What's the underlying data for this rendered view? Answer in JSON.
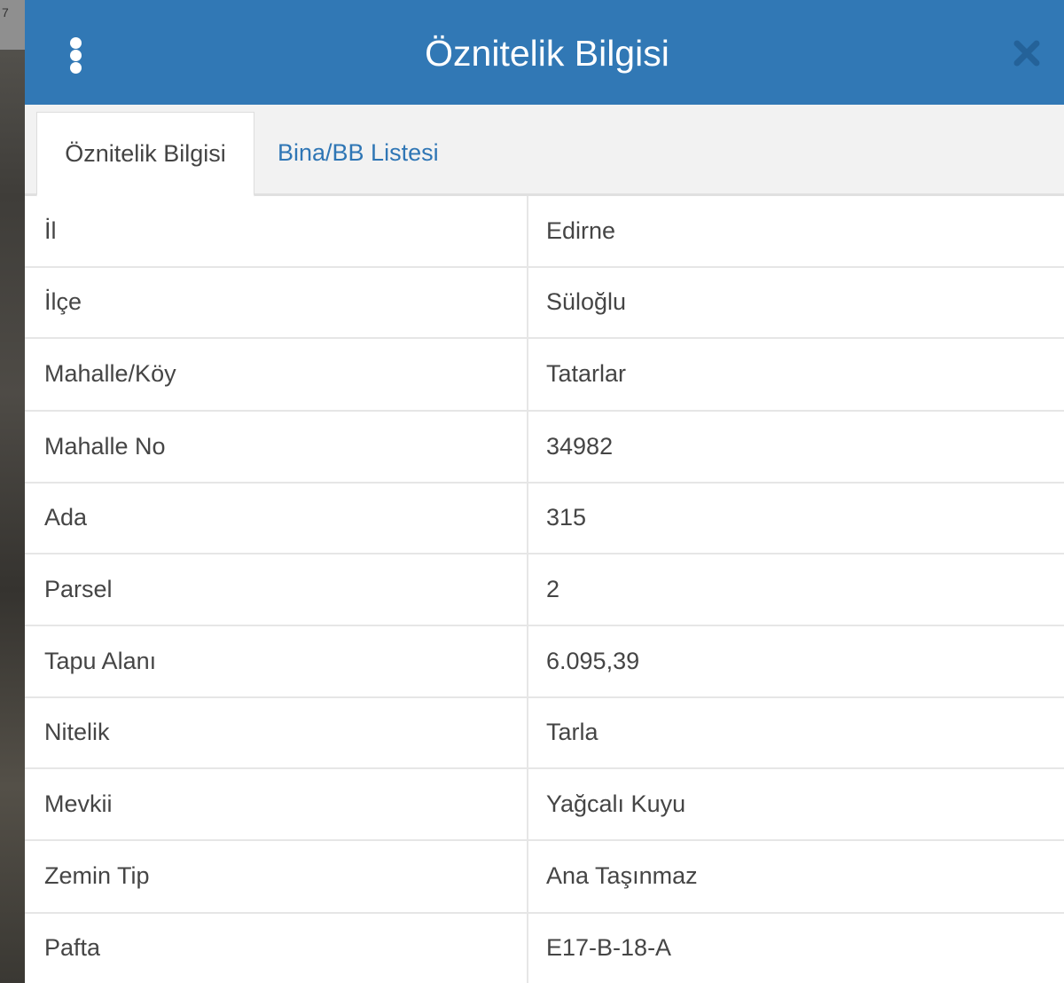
{
  "background": {
    "edge_label": "7"
  },
  "header": {
    "title": "Öznitelik Bilgisi",
    "background_color": "#3178b5",
    "menu_icon": "vertical-dots-icon",
    "close_icon": "close-icon"
  },
  "tabs": [
    {
      "label": "Öznitelik Bilgisi",
      "active": true
    },
    {
      "label": "Bina/BB Listesi",
      "active": false
    }
  ],
  "attributes": {
    "columns": [
      "key",
      "value"
    ],
    "rows": [
      {
        "key": "İl",
        "value": "Edirne"
      },
      {
        "key": "İlçe",
        "value": "Süloğlu"
      },
      {
        "key": "Mahalle/Köy",
        "value": "Tatarlar"
      },
      {
        "key": "Mahalle No",
        "value": "34982"
      },
      {
        "key": "Ada",
        "value": "315"
      },
      {
        "key": "Parsel",
        "value": "2"
      },
      {
        "key": "Tapu Alanı",
        "value": "6.095,39"
      },
      {
        "key": "Nitelik",
        "value": "Tarla"
      },
      {
        "key": "Mevkii",
        "value": "Yağcalı Kuyu"
      },
      {
        "key": "Zemin Tip",
        "value": "Ana Taşınmaz"
      },
      {
        "key": "Pafta",
        "value": "E17-B-18-A"
      }
    ]
  }
}
